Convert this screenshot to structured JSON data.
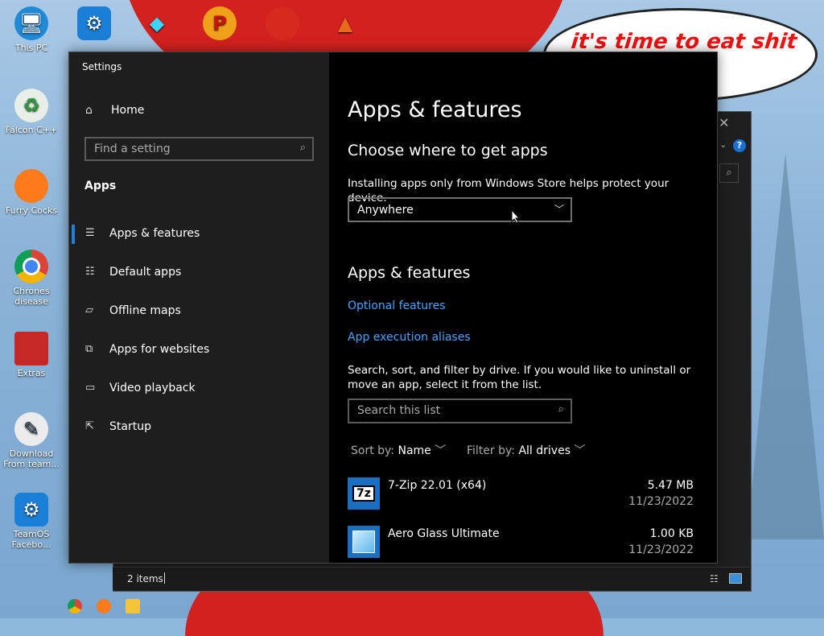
{
  "desktop": {
    "speech_text": "it's time to eat shit chew",
    "icons": [
      {
        "label": "This PC"
      },
      {
        "label": "Falcon C++"
      },
      {
        "label": "Furry Cocks"
      },
      {
        "label": "Chrones disease"
      },
      {
        "label": "Extras"
      },
      {
        "label": "Download From team..."
      },
      {
        "label": "TeamOS Facebo..."
      }
    ]
  },
  "background_window": {
    "status_count": "2 items",
    "help": "?"
  },
  "settings": {
    "window_title": "Settings",
    "nav": {
      "home": "Home",
      "find_placeholder": "Find a setting",
      "section": "Apps",
      "items": [
        {
          "label": "Apps & features",
          "icon": "list-icon",
          "active": true
        },
        {
          "label": "Default apps",
          "icon": "default-apps-icon"
        },
        {
          "label": "Offline maps",
          "icon": "map-icon"
        },
        {
          "label": "Apps for websites",
          "icon": "open-in-app-icon"
        },
        {
          "label": "Video playback",
          "icon": "video-icon"
        },
        {
          "label": "Startup",
          "icon": "startup-icon"
        }
      ]
    },
    "main": {
      "title": "Apps & features",
      "choose_heading": "Choose where to get apps",
      "choose_desc": "Installing apps only from Windows Store helps protect your device.",
      "source_value": "Anywhere",
      "section_heading": "Apps & features",
      "link_optional": "Optional features",
      "link_aliases": "App execution aliases",
      "search_desc": "Search, sort, and filter by drive. If you would like to uninstall or move an app, select it from the list.",
      "search_placeholder": "Search this list",
      "sort_label": "Sort by:",
      "sort_value": "Name",
      "filter_label": "Filter by:",
      "filter_value": "All drives",
      "apps": [
        {
          "name": "7-Zip 22.01 (x64)",
          "size": "5.47 MB",
          "date": "11/23/2022",
          "tile_text": "7z"
        },
        {
          "name": "Aero Glass Ultimate",
          "size": "1.00 KB",
          "date": "11/23/2022",
          "tile_text": ""
        }
      ]
    }
  }
}
